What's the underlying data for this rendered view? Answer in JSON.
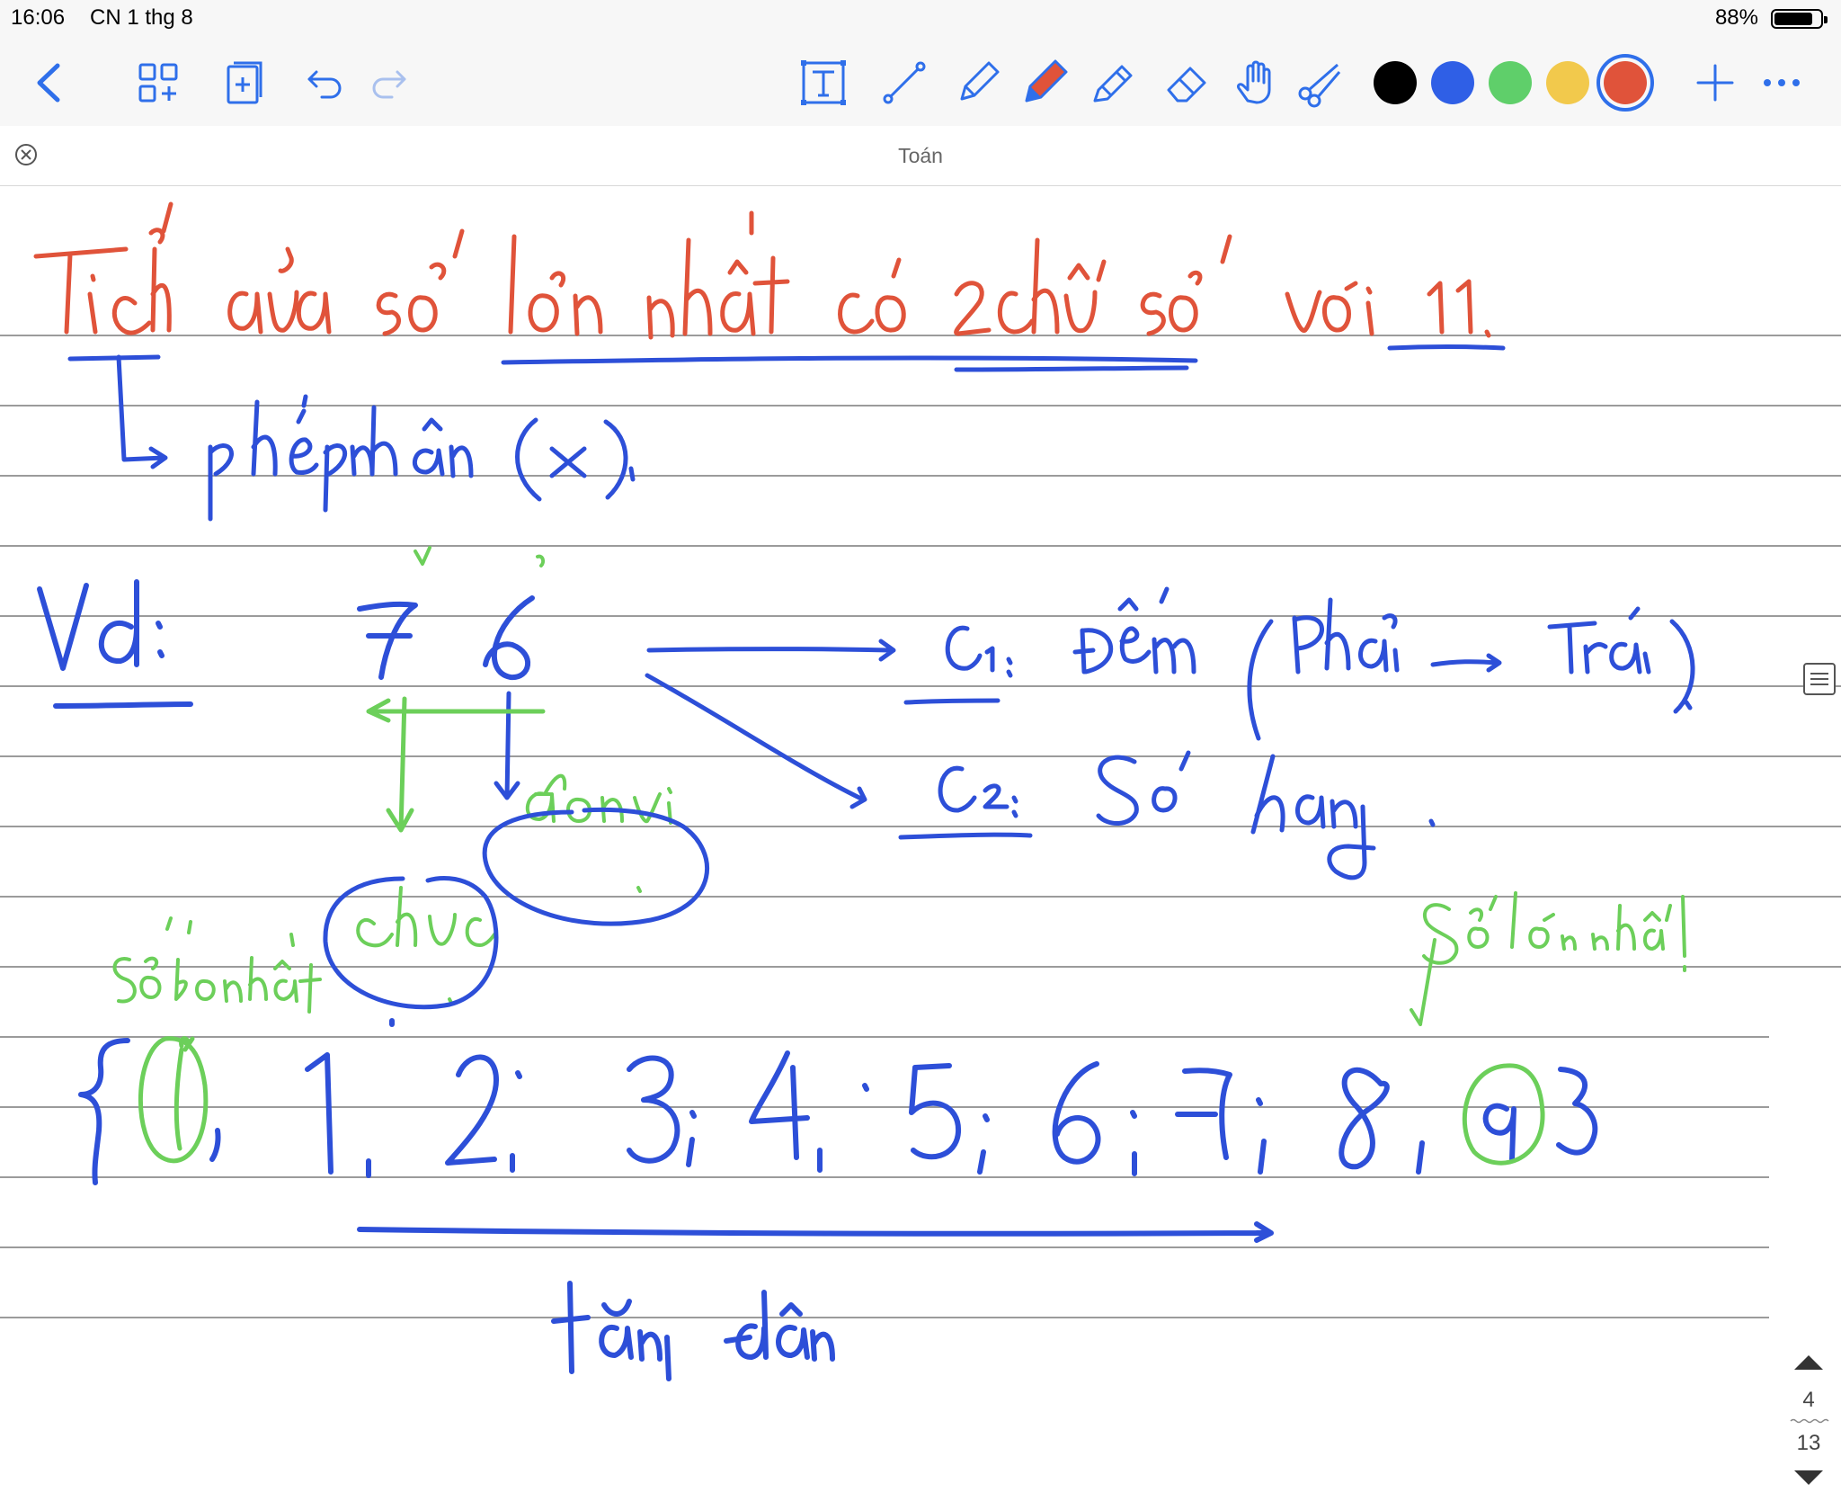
{
  "status_bar": {
    "time": "16:06",
    "date": "CN 1 thg 8",
    "battery": "88%",
    "battery_level": 0.88
  },
  "toolbar": {
    "tools": [
      "back-icon",
      "thumbnails-icon",
      "add-page-icon",
      "undo-icon",
      "redo-icon",
      "text-tool-icon",
      "line-tool-icon",
      "pencil-tool-icon",
      "pen-tool-icon",
      "highlighter-tool-icon",
      "eraser-tool-icon",
      "hand-tool-icon",
      "scissors-tool-icon",
      "plus-icon",
      "more-icon"
    ],
    "colors": [
      "#000000",
      "#2f5fe6",
      "#5fcf6a",
      "#f2c94c",
      "#e0533a"
    ],
    "selected_color": "#e0533a"
  },
  "document": {
    "title": "Toán"
  },
  "pager": {
    "current": "4",
    "total": "13"
  },
  "ink_colors": {
    "red": "#e0533a",
    "blue": "#2d4fd8",
    "green": "#6ccf5a"
  }
}
